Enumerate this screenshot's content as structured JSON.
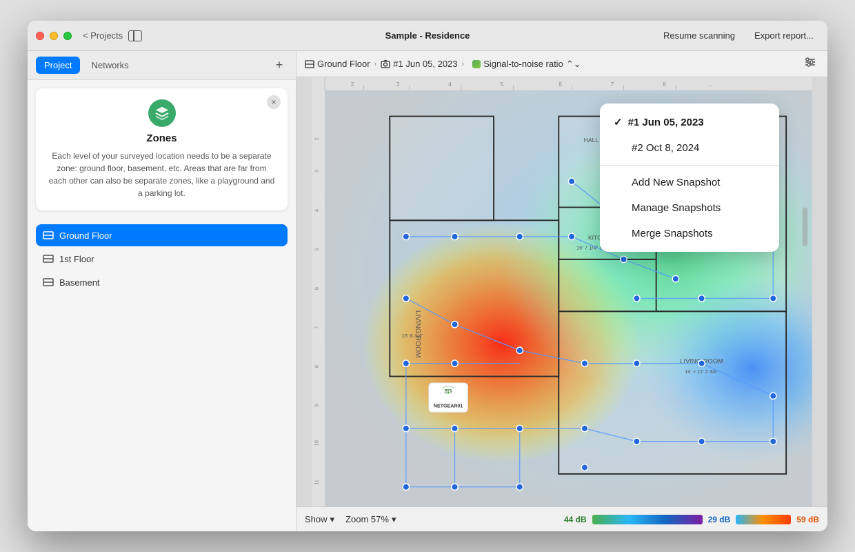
{
  "window": {
    "title": "Sample - Residence"
  },
  "titlebar": {
    "back_label": "< Projects",
    "resume_label": "Resume scanning",
    "export_label": "Export report..."
  },
  "sidebar": {
    "tabs": [
      {
        "id": "project",
        "label": "Project",
        "active": true
      },
      {
        "id": "networks",
        "label": "Networks",
        "active": false
      }
    ],
    "add_label": "+",
    "zones_card": {
      "title": "Zones",
      "description": "Each level of your surveyed location needs to be a separate zone: ground floor, basement, etc. Areas that are far from each other can also be separate zones, like a playground and a parking lot.",
      "close_label": "×"
    },
    "floors": [
      {
        "id": "ground",
        "label": "Ground Floor",
        "active": true
      },
      {
        "id": "first",
        "label": "1st Floor",
        "active": false
      },
      {
        "id": "basement",
        "label": "Basement",
        "active": false
      }
    ]
  },
  "toolbar": {
    "breadcrumb_floor": "Ground Floor",
    "breadcrumb_snapshot": "#1 Jun 05, 2023",
    "breadcrumb_signal": "Signal-to-noise ratio",
    "filter_icon": "⚙"
  },
  "dropdown": {
    "items": [
      {
        "label": "#1 Jun 05, 2023",
        "checked": true
      },
      {
        "label": "#2 Oct 8, 2024",
        "checked": false
      }
    ],
    "actions": [
      {
        "label": "Add New Snapshot"
      },
      {
        "label": "Manage Snapshots"
      },
      {
        "label": "Merge Snapshots"
      }
    ]
  },
  "bottombar": {
    "show_label": "Show",
    "zoom_label": "Zoom 57%",
    "legend_low": "44 dB",
    "legend_mid": "29 dB",
    "legend_high": "59 dB"
  },
  "icons": {
    "chevron_right": "›",
    "chevron_down": "⌄",
    "checkmark": "✓"
  }
}
